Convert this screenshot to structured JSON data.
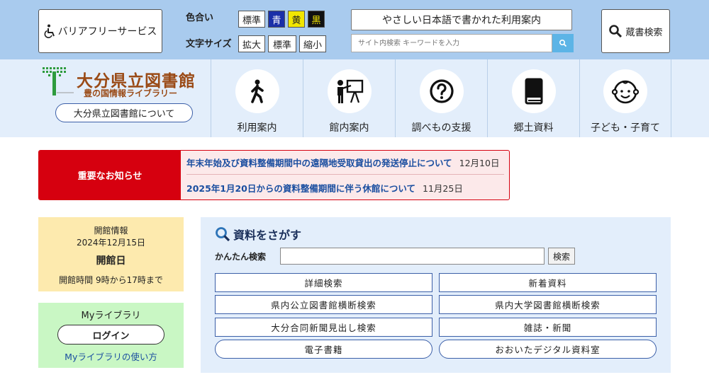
{
  "topbar": {
    "barrier_free": "バリアフリーサービス",
    "color_label": "色合い",
    "colors": [
      {
        "label": "標準",
        "bg": "#ffffff",
        "fg": "#222222"
      },
      {
        "label": "青",
        "bg": "#1a2fa8",
        "fg": "#ffffff"
      },
      {
        "label": "黄",
        "bg": "#f2e600",
        "fg": "#222222"
      },
      {
        "label": "黒",
        "bg": "#111111",
        "fg": "#f2e600"
      }
    ],
    "font_size_label": "文字サイズ",
    "sizes": [
      "拡大",
      "標準",
      "縮小"
    ],
    "easy_japanese": "やさしい日本語で書かれた利用案内",
    "site_search_placeholder": "サイト内検索 キーワードを入力",
    "collection_search": "蔵書検索"
  },
  "header": {
    "logo_title": "大分県立図書館",
    "logo_subtitle": "豊の国情報ライブラリー",
    "about": "大分県立図書館について",
    "nav": [
      {
        "label": "利用案内",
        "icon": "walking-person-icon"
      },
      {
        "label": "館内案内",
        "icon": "presenter-board-icon"
      },
      {
        "label": "調べもの支援",
        "icon": "question-mark-icon"
      },
      {
        "label": "郷土資料",
        "icon": "book-icon"
      },
      {
        "label": "子ども・子育て",
        "icon": "child-face-icon"
      }
    ]
  },
  "notice": {
    "label": "重要なお知らせ",
    "items": [
      {
        "text": "年末年始及び資料整備期間中の遠隔地受取貸出の発送停止について",
        "date": "12月10日"
      },
      {
        "text": "2025年1月20日からの資料整備期間に伴う休館について",
        "date": "11月25日"
      }
    ]
  },
  "opening": {
    "title": "開館情報",
    "date": "2024年12月15日",
    "status": "開館日",
    "hours": "開館時間 9時から17時まで"
  },
  "mylibrary": {
    "title": "Myライブラリ",
    "login": "ログイン",
    "howto": "Myライブラリの使い方"
  },
  "search": {
    "title": "資料をさがす",
    "easy_label": "かんたん検索",
    "easy_button": "検索",
    "links": [
      "詳細検索",
      "新着資料",
      "県内公立図書館横断検索",
      "県内大学図書館横断検索",
      "大分合同新聞見出し検索",
      "雑誌・新聞",
      "電子書籍",
      "おおいたデジタル資料室"
    ]
  },
  "colors": {
    "topbar_bg": "#a9cbee",
    "nav_bg": "#e3eefb",
    "brand_brown": "#9a4a16",
    "alert_red": "#d6000f",
    "link_blue": "#1a4ea0"
  }
}
